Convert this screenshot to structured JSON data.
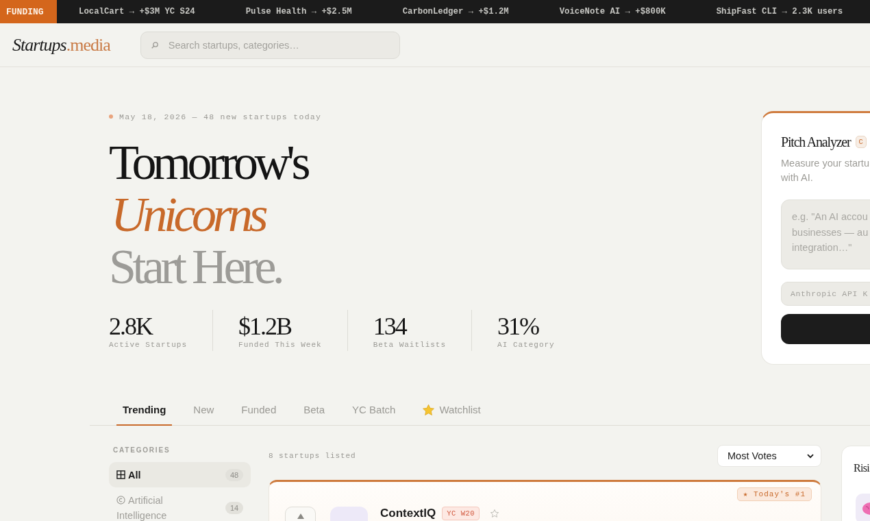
{
  "ticker": {
    "label": "FUNDING",
    "items": [
      "LocalCart → +$3M YC S24",
      "Pulse Health → +$2.5M",
      "CarbonLedger → +$1.2M",
      "VoiceNote AI → +$800K",
      "ShipFast CLI → 2.3K users"
    ]
  },
  "header": {
    "logo": "*Startups*.media",
    "search": {
      "placeholder": "Search startups, categories…"
    }
  },
  "hero": {
    "date_line": "May 18, 2026 — 48 new startups today",
    "headline": [
      {
        "text": "Tomorrow's",
        "kind": "plain"
      },
      {
        "text": "Unicorns",
        "kind": "accent"
      },
      {
        "text": "Start Here.",
        "kind": "muted"
      }
    ],
    "stats": [
      {
        "value": "2.8K",
        "label": "Active Startups"
      },
      {
        "value": "$1.2B",
        "label": "Funded This Week"
      },
      {
        "value": "134",
        "label": "Beta Waitlists"
      },
      {
        "value": "31%",
        "label": "AI Category"
      }
    ]
  },
  "pitch_analyzer": {
    "title": "Pitch Analyzer",
    "badge": "C",
    "description": "Measure your startu\nwith AI.",
    "pitch_field": {
      "placeholder": "e.g. \"An AI accou\nbusinesses — au\nintegration…\""
    },
    "api_key_field": {
      "placeholder": "Anthropic API K"
    }
  },
  "tabs": [
    {
      "label": "Trending",
      "selected": true,
      "kind": "filter"
    },
    {
      "label": "New",
      "selected": false,
      "kind": "filter"
    },
    {
      "label": "Funded",
      "selected": false,
      "kind": "filter"
    },
    {
      "label": "Beta",
      "selected": false,
      "kind": "filter"
    },
    {
      "label": "YC Batch",
      "selected": false,
      "kind": "filter"
    },
    {
      "label": "Watchlist",
      "selected": false,
      "kind": "watchlist"
    }
  ],
  "categories": {
    "heading": "CATEGORIES",
    "items": [
      {
        "label": "All",
        "count": "48",
        "selected": true,
        "kind": "all"
      },
      {
        "label": "Artificial Intelligence",
        "count": "14",
        "selected": false,
        "kind": "topic"
      }
    ]
  },
  "listing": {
    "count_text": "8 startups listed",
    "sort": {
      "value": "Most Votes"
    },
    "startups": [
      {
        "name": "ContextIQ",
        "badge": "YC W20",
        "highlight": "★ Today's #1",
        "featured": true,
        "watched": false
      }
    ]
  },
  "rising": {
    "title": "Risi"
  }
}
